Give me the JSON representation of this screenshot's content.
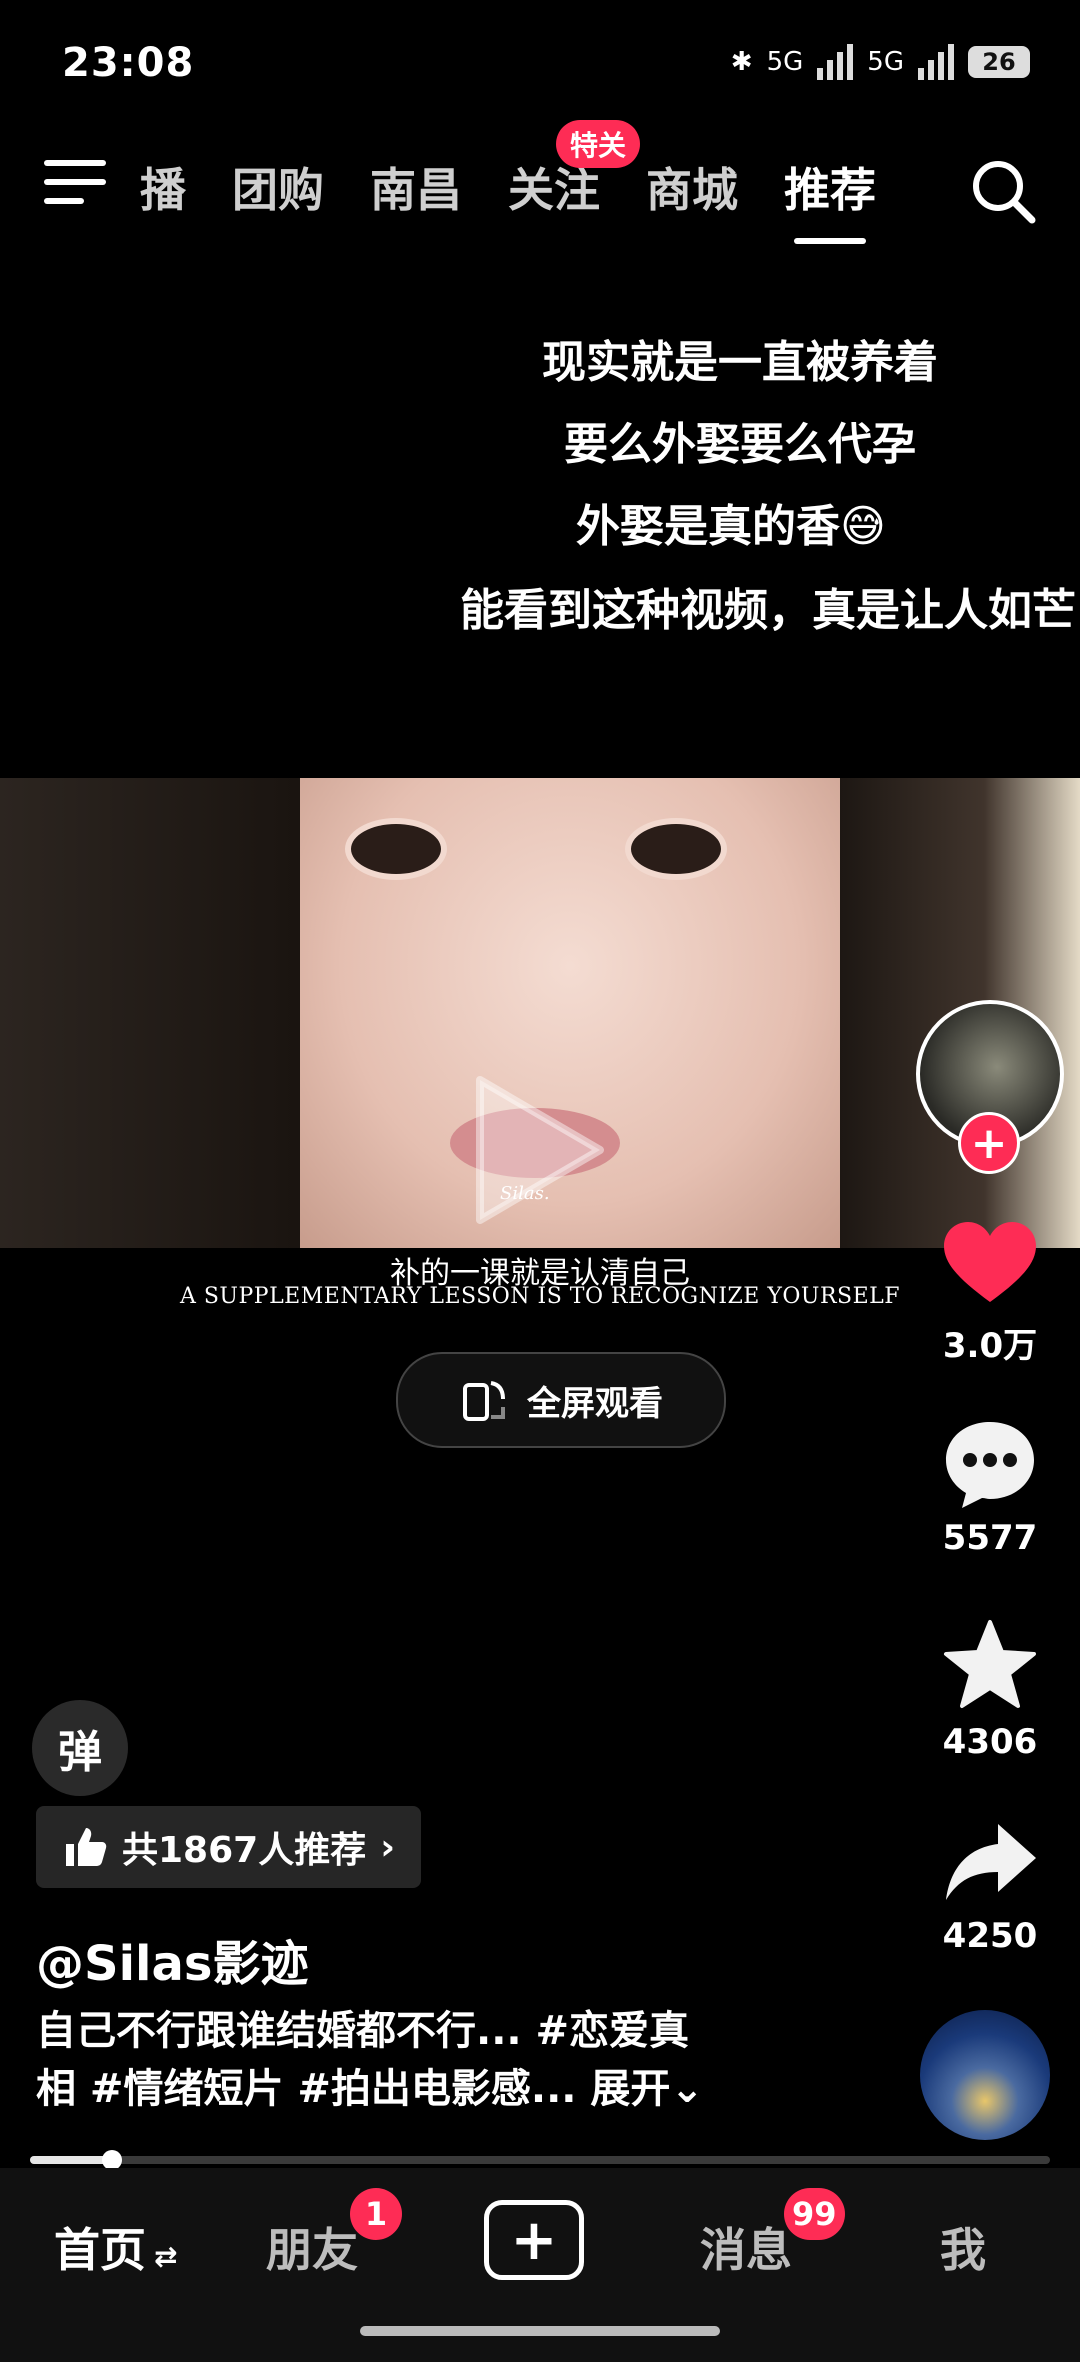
{
  "status_bar": {
    "time": "23:08",
    "network1": "5G",
    "network2": "5G",
    "battery": "26"
  },
  "top_nav": {
    "tabs": [
      "播",
      "团购",
      "南昌",
      "关注",
      "商城",
      "推荐"
    ],
    "follow_badge": "特关",
    "active_tab": "推荐"
  },
  "caption_lines": [
    "现实就是一直被养着",
    "要么外娶要么代孕",
    "外娶是真的香😅",
    "能看到这种视频，真是让人如芒"
  ],
  "video": {
    "watermark": "Silas.",
    "subtitle_cn": "补的一课就是认清自己",
    "subtitle_en": "A SUPPLEMENTARY LESSON IS TO RECOGNIZE YOURSELF"
  },
  "fullscreen_label": "全屏观看",
  "right_rail": {
    "likes": "3.0万",
    "comments": "5577",
    "favorites": "4306",
    "shares": "4250",
    "like_color": "#fe2c55"
  },
  "danmu_label": "弹",
  "recommend_label": "共1867人推荐",
  "author": "@Silas影迹",
  "description": {
    "line1": "自己不行跟谁结婚都不行... #恋爱真",
    "line2": "相 #情绪短片 #拍出电影感...",
    "expand": "展开"
  },
  "progress": {
    "fraction": 0.08
  },
  "bottom_nav": {
    "home": "首页",
    "friends": "朋友",
    "friends_badge": "1",
    "messages": "消息",
    "messages_badge": "99",
    "me": "我"
  }
}
